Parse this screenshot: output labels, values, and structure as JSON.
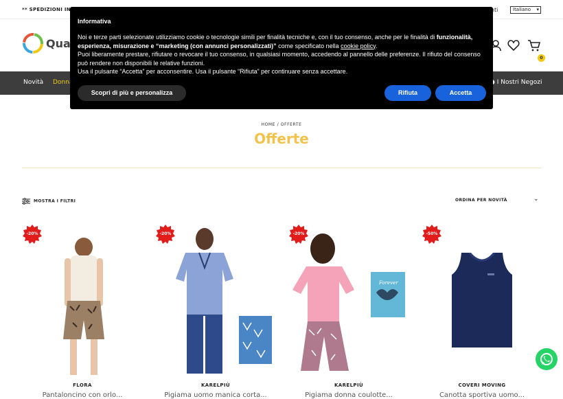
{
  "topbar": {
    "shipping": "** SPEDIZIONI IN ITA",
    "account": "enti",
    "language": "Italiano"
  },
  "header": {
    "logo_text": "Quat",
    "cart_count": "0"
  },
  "nav": {
    "novita": "Novità",
    "donna": "Donna",
    "negozi": "I Nostri Negozi"
  },
  "page": {
    "breadcrumb": "HOME / OFFERTE",
    "title": "Offerte"
  },
  "toolbar": {
    "filters": "MOSTRA I FILTRI",
    "sort": "ORDINA PER NOVITÀ"
  },
  "colors": {
    "accent": "#f2c811",
    "discount": "#e21b1b",
    "consent_button": "#1863dc",
    "whatsapp": "#25d366"
  },
  "products": [
    {
      "discount": "-20%",
      "brand": "FLORA",
      "name": "Pantaloncino con orlo..."
    },
    {
      "discount": "-20%",
      "brand": "KARELPIÙ",
      "name": "Pigiama uomo manica corta..."
    },
    {
      "discount": "-20%",
      "brand": "KARELPIÙ",
      "name": "Pigiama donna coulotte..."
    },
    {
      "discount": "-50%",
      "brand": "COVERI MOVING",
      "name": "Canotta sportiva uomo..."
    }
  ],
  "consent": {
    "title": "Informativa",
    "line1_a": "Noi e terze parti selezionate utilizziamo cookie o tecnologie simili per finalità tecniche e, con il tuo consenso, anche per le finalità di ",
    "line1_b": "funzionalità, esperienza, misurazione e “marketing (con annunci personalizzati)”",
    "line1_c": " come specificato nella ",
    "link": "cookie policy",
    "line1_d": ".",
    "line2": "Puoi liberamente prestare, rifiutare o revocare il tuo consenso, in qualsiasi momento, accedendo al pannello delle preferenze. Il rifiuto del consenso può rendere non disponibili le relative funzioni.",
    "line3": "Usa il pulsante “Accetta” per acconsentire. Usa il pulsante “Rifiuta” per continuare senza accettare.",
    "learn_more": "Scopri di più e personalizza",
    "reject": "Rifiuta",
    "accept": "Accetta"
  }
}
